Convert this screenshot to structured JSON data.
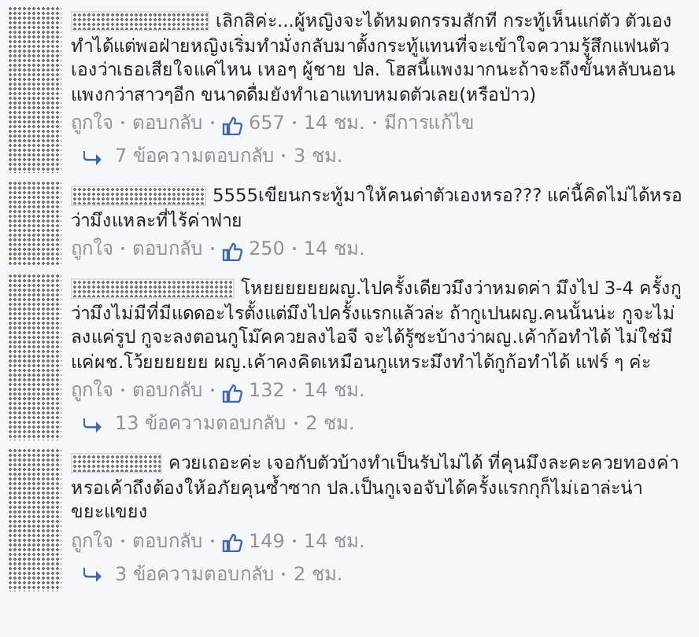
{
  "comments": [
    {
      "text": "เลิกสิค่ะ...ผู้หญิงจะได้หมดกรรมสักที กระทู้เห็นแก่ตัว ตัวเองทำได้แต่พอฝ่ายหญิงเริ่มทำมั่งกลับมาตั้งกระทู้แทนที่จะเข้าใจความรู้สึกแฟนตัวเองว่าเธอเสียใจแค่ไหน เหอๆ ผู้ชาย ปล. โฮสนี้แพงมากนะถ้าจะถึงขั้นหลับนอน แพงกว่าสาวๆอีก ขนาดดื่มยังทำเอาแทบหมดตัวเลย(หรือป่าว)",
      "like": "ถูกใจ",
      "reply": "ตอบกลับ",
      "likes": "657",
      "time": "14 ชม.",
      "edited": "มีการแก้ไข",
      "replies": {
        "count": "7 ข้อความตอบกลับ",
        "time": "3 ชม."
      }
    },
    {
      "text": "5555เขียนกระทู้มาให้คนด่าตัวเองหรอ??? แค่นี้คิดไม่ได้หรอว่ามึงแหละที่ไร้ค่าฟาย",
      "like": "ถูกใจ",
      "reply": "ตอบกลับ",
      "likes": "250",
      "time": "14 ชม."
    },
    {
      "text": "โหยยยยยยผญ.ไปครั้งเดียวมึงว่าหมดค่า มึงไป 3-4 ครั้งกูว่ามึงไม่มีที่มีแดดอะไรตั้งแต่มึงไปครั้งแรกแล้วล่ะ ถ้ากูเปนผญ.คนนั้นน่ะ กูจะไม่ลงแค่รูป กูจะลงตอนกูโม๊คควยลงไอจี จะได้รู้ซะบ้างว่าผญ.เค้าก้อทำได้ ไม่ใช่มีแค่ผช.โว้ยยยยยย ผญ.เค้าคงคิดเหมือนกูแหระมึงทำได้กูก้อทำได้ แฟร์ ๆ ค่ะ",
      "like": "ถูกใจ",
      "reply": "ตอบกลับ",
      "likes": "132",
      "time": "14 ชม.",
      "replies": {
        "count": "13 ข้อความตอบกลับ",
        "time": "2 ชม."
      }
    },
    {
      "text": "ควยเถอะค่ะ เจอกับตัวบ้างทำเป็นรับไม่ได้ ที่คุนมึงละคะควยทองค่าหรอเค้าถึงต้องให้อภัยคุนซ้ำซาก ปล.เป็นกูเจอจับได้ครั้งแรกกุก็ไม่เอาล่ะน่าขยะแขยง",
      "like": "ถูกใจ",
      "reply": "ตอบกลับ",
      "likes": "149",
      "time": "14 ชม.",
      "replies": {
        "count": "3 ข้อความตอบกลับ",
        "time": "2 ชม."
      }
    }
  ]
}
